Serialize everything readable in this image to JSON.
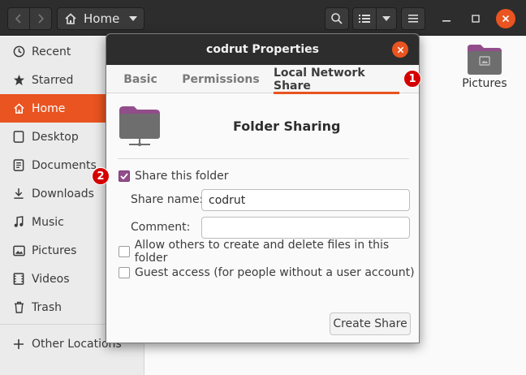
{
  "window": {
    "path_label": "Home"
  },
  "sidebar": {
    "items": [
      {
        "label": "Recent",
        "icon": "clock-icon"
      },
      {
        "label": "Starred",
        "icon": "star-icon"
      },
      {
        "label": "Home",
        "icon": "home-icon",
        "active": true
      },
      {
        "label": "Desktop",
        "icon": "desktop-icon"
      },
      {
        "label": "Documents",
        "icon": "document-icon"
      },
      {
        "label": "Downloads",
        "icon": "download-icon"
      },
      {
        "label": "Music",
        "icon": "music-icon"
      },
      {
        "label": "Pictures",
        "icon": "image-icon"
      },
      {
        "label": "Videos",
        "icon": "video-icon"
      },
      {
        "label": "Trash",
        "icon": "trash-icon"
      }
    ],
    "other_locations": "Other Locations"
  },
  "files": [
    {
      "label": "Pictures"
    }
  ],
  "dialog": {
    "title": "codrut Properties",
    "tabs": [
      {
        "label": "Basic"
      },
      {
        "label": "Permissions"
      },
      {
        "label": "Local Network Share",
        "active": true
      }
    ],
    "heading": "Folder Sharing",
    "share_checkbox": {
      "label": "Share this folder",
      "checked": true
    },
    "share_name": {
      "label": "Share name:",
      "value": "codrut"
    },
    "comment": {
      "label": "Comment:",
      "value": ""
    },
    "allow_others": {
      "label": "Allow others to create and delete files in this folder",
      "checked": false
    },
    "guest_access": {
      "label": "Guest access (for people without a user account)",
      "checked": false
    },
    "create_button": "Create Share"
  },
  "markers": [
    "1",
    "2"
  ],
  "colors": {
    "accent": "#e95420",
    "checkbox": "#924d8b",
    "marker": "#d40000"
  }
}
